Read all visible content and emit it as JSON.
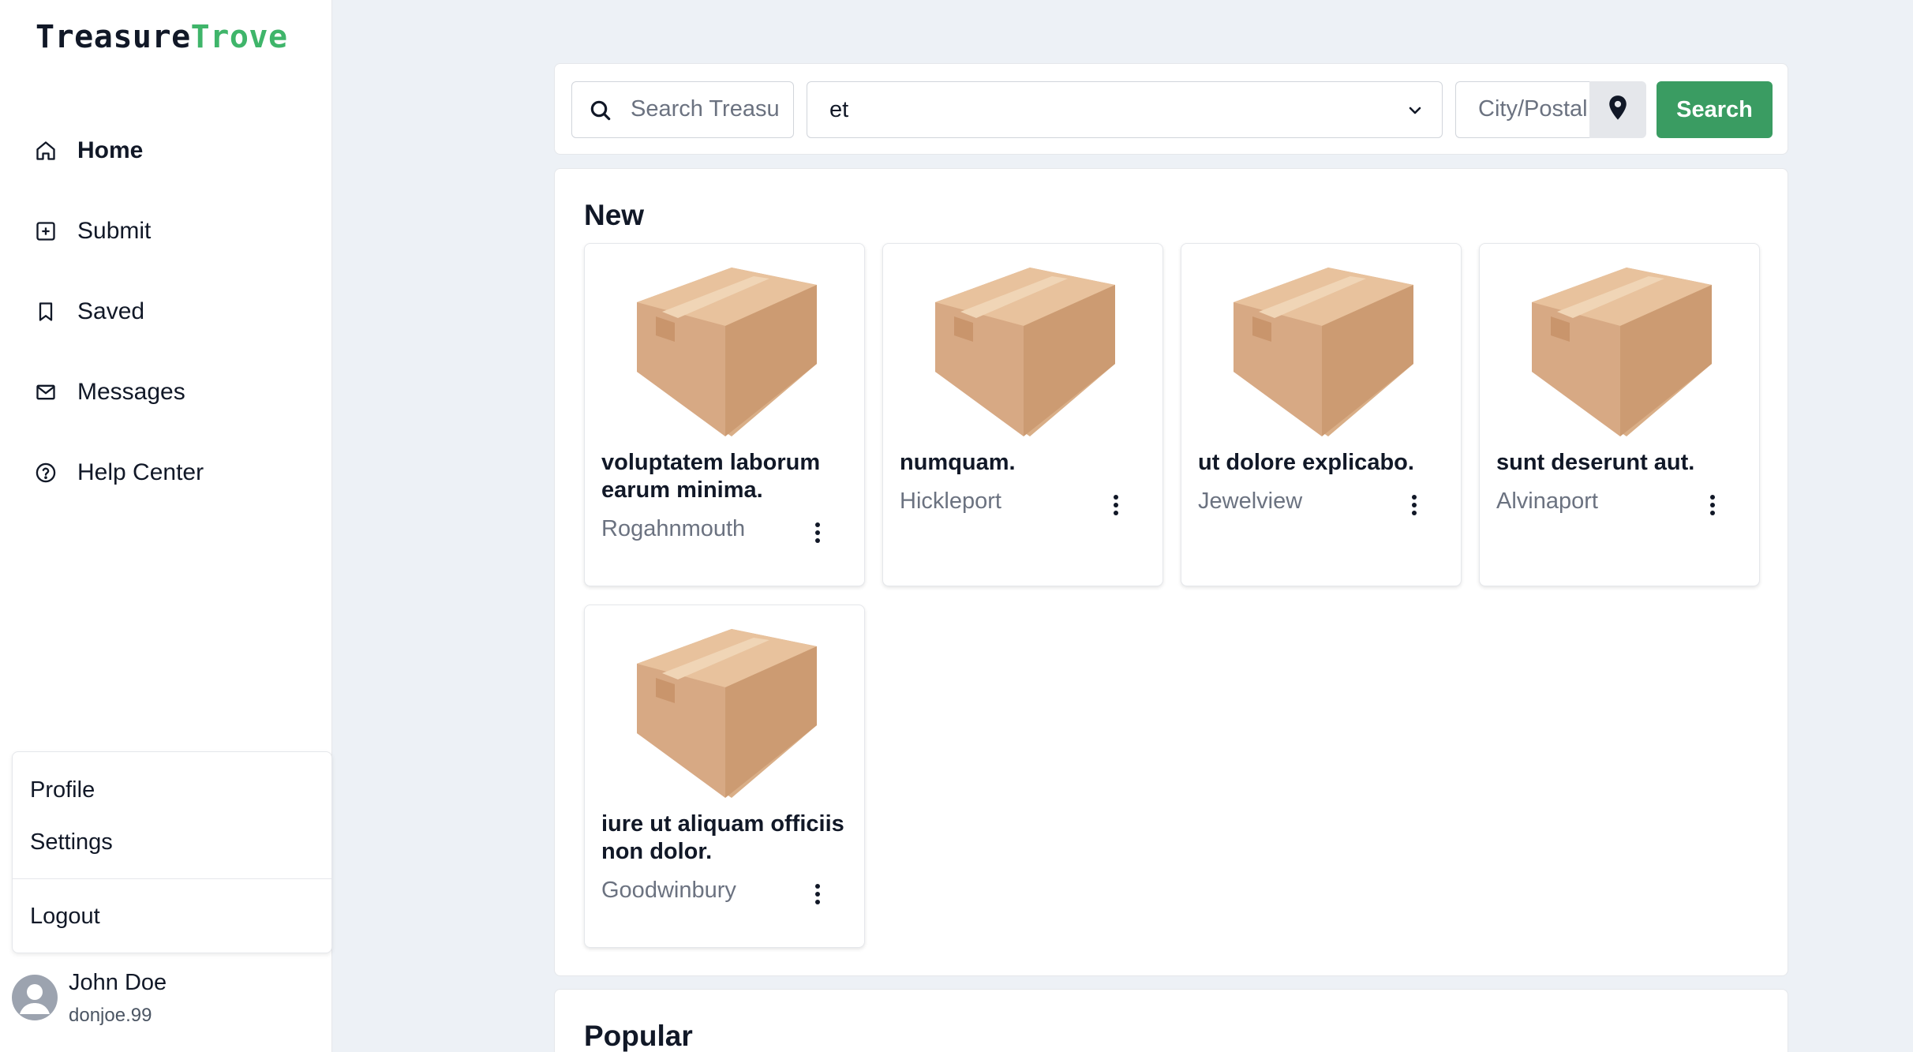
{
  "app": {
    "logo_part1": "Treasure",
    "logo_part2": "Trove",
    "brand_color": "#3fb56a"
  },
  "sidebar": {
    "items": [
      {
        "label": "Home",
        "icon": "home-icon",
        "active": true
      },
      {
        "label": "Submit",
        "icon": "plus-square-icon"
      },
      {
        "label": "Saved",
        "icon": "bookmark-icon"
      },
      {
        "label": "Messages",
        "icon": "mail-icon"
      },
      {
        "label": "Help Center",
        "icon": "help-circle-icon"
      }
    ],
    "account_menu": {
      "profile": "Profile",
      "settings": "Settings",
      "logout": "Logout"
    },
    "user": {
      "name": "John Doe",
      "handle": "donjoe.99"
    }
  },
  "search": {
    "placeholder": "Search Treasu",
    "category_value": "et",
    "location_placeholder": "City/Postal",
    "button_label": "Search",
    "button_color": "#3a9c62"
  },
  "sections": {
    "new_title": "New",
    "popular_title": "Popular"
  },
  "cards": [
    {
      "title": "voluptatem laborum earum minima.",
      "location": "Rogahnmouth"
    },
    {
      "title": "numquam.",
      "location": "Hickleport"
    },
    {
      "title": "ut dolore explicabo.",
      "location": "Jewelview"
    },
    {
      "title": "sunt deserunt aut.",
      "location": "Alvinaport"
    },
    {
      "title": "iure ut aliquam officiis non dolor.",
      "location": "Goodwinbury"
    }
  ]
}
